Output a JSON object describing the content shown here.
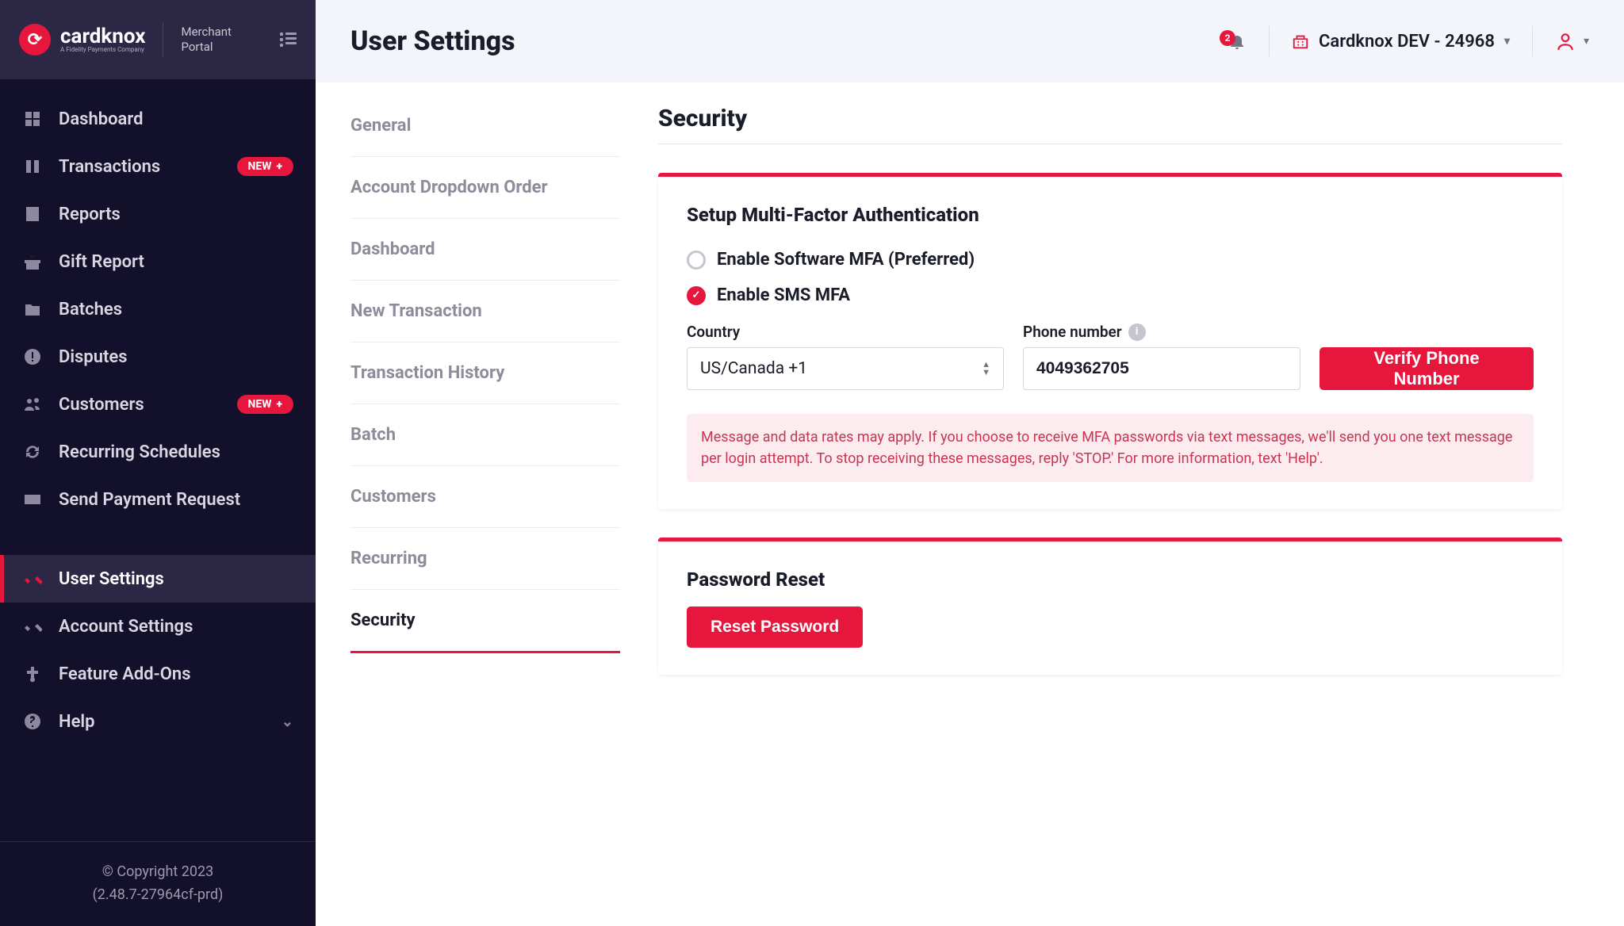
{
  "brand": {
    "name": "cardknox",
    "sub": "A Fidelity Payments Company",
    "portal": "Merchant Portal"
  },
  "nav": [
    {
      "label": "Dashboard",
      "icon": "grid"
    },
    {
      "label": "Transactions",
      "icon": "transactions",
      "badge": "NEW"
    },
    {
      "label": "Reports",
      "icon": "reports"
    },
    {
      "label": "Gift Report",
      "icon": "gift"
    },
    {
      "label": "Batches",
      "icon": "folder"
    },
    {
      "label": "Disputes",
      "icon": "alert"
    },
    {
      "label": "Customers",
      "icon": "customers",
      "badge": "NEW"
    },
    {
      "label": "Recurring Schedules",
      "icon": "recurring"
    },
    {
      "label": "Send Payment Request",
      "icon": "send-payment"
    },
    {
      "label": "User Settings",
      "icon": "user-settings",
      "active": true
    },
    {
      "label": "Account Settings",
      "icon": "account-settings"
    },
    {
      "label": "Feature Add-Ons",
      "icon": "feature"
    },
    {
      "label": "Help",
      "icon": "help",
      "chevron": true
    }
  ],
  "footer": {
    "copyright": "© Copyright 2023",
    "version": "(2.48.7-27964cf-prd)"
  },
  "header": {
    "title": "User Settings",
    "notif_count": "2",
    "account": "Cardknox DEV - 24968"
  },
  "tabs": [
    "General",
    "Account Dropdown Order",
    "Dashboard",
    "New Transaction",
    "Transaction History",
    "Batch",
    "Customers",
    "Recurring",
    "Security"
  ],
  "active_tab": "Security",
  "security": {
    "title": "Security",
    "mfa": {
      "title": "Setup Multi-Factor Authentication",
      "opt_software": "Enable Software MFA (Preferred)",
      "opt_sms": "Enable SMS MFA",
      "country_label": "Country",
      "country_value": "US/Canada +1",
      "phone_label": "Phone number",
      "phone_value": "4049362705",
      "verify_btn": "Verify Phone Number",
      "alert": "Message and data rates may apply. If you choose to receive MFA passwords via text messages, we'll send you one text message per login attempt. To stop receiving these messages, reply 'STOP.' For more information, text 'Help'."
    },
    "password": {
      "title": "Password Reset",
      "btn": "Reset Password"
    }
  }
}
